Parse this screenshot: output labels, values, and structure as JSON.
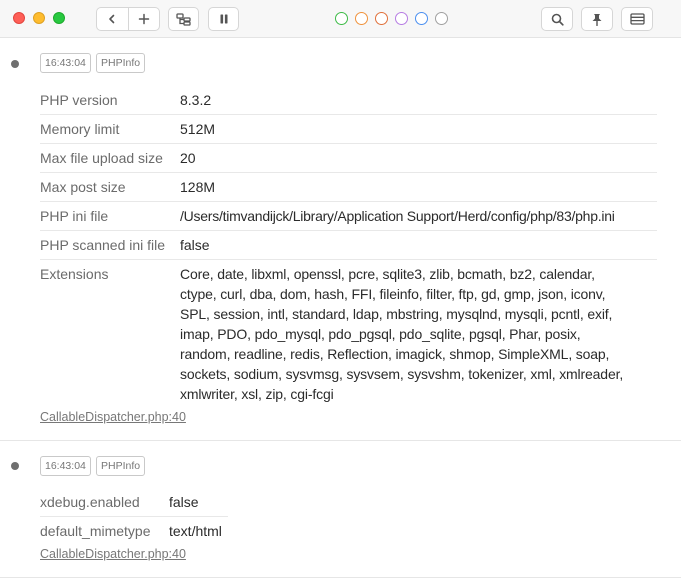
{
  "toolbar": {
    "back_icon": "chevron-left-icon",
    "add_icon": "plus-icon",
    "tree_icon": "hierarchy-icon",
    "pause_icon": "pause-icon",
    "search_icon": "search-icon",
    "pin_icon": "pin-icon",
    "menu_icon": "list-icon",
    "color_filters": [
      "#3dbb47",
      "#f0923c",
      "#e0703a",
      "#b67ce3",
      "#4a8ff0",
      "#a0a0a0"
    ]
  },
  "entries": [
    {
      "time": "16:43:04",
      "label": "PHPInfo",
      "rows": [
        {
          "key": "PHP version",
          "value": "8.3.2"
        },
        {
          "key": "Memory limit",
          "value": "512M"
        },
        {
          "key": "Max file upload size",
          "value": "20"
        },
        {
          "key": "Max post size",
          "value": "128M"
        },
        {
          "key": "PHP ini file",
          "value": "/Users/timvandijck/Library/Application Support/Herd/config/php/83/php.ini"
        },
        {
          "key": "PHP scanned ini file",
          "value": "false"
        },
        {
          "key": "Extensions",
          "value_lines": [
            "Core, date, libxml, openssl, pcre, sqlite3, zlib, bcmath, bz2, calendar,",
            "ctype, curl, dba, dom, hash, FFI, fileinfo, filter, ftp, gd, gmp, json, iconv,",
            "SPL, session, intl, standard, ldap, mbstring, mysqlnd, mysqli, pcntl, exif,",
            "imap, PDO, pdo_mysql, pdo_pgsql, pdo_sqlite, pgsql, Phar, posix,",
            "random, readline, redis, Reflection, imagick, shmop, SimpleXML, soap,",
            "sockets, sodium, sysvmsg, sysvsem, sysvshm, tokenizer, xml, xmlreader,",
            "xmlwriter, xsl, zip, cgi-fcgi"
          ]
        }
      ],
      "source": "CallableDispatcher.php:40"
    },
    {
      "time": "16:43:04",
      "label": "PHPInfo",
      "rows": [
        {
          "key": "xdebug.enabled",
          "value": "false"
        },
        {
          "key": "default_mimetype",
          "value": "text/html"
        }
      ],
      "source": "CallableDispatcher.php:40"
    }
  ]
}
